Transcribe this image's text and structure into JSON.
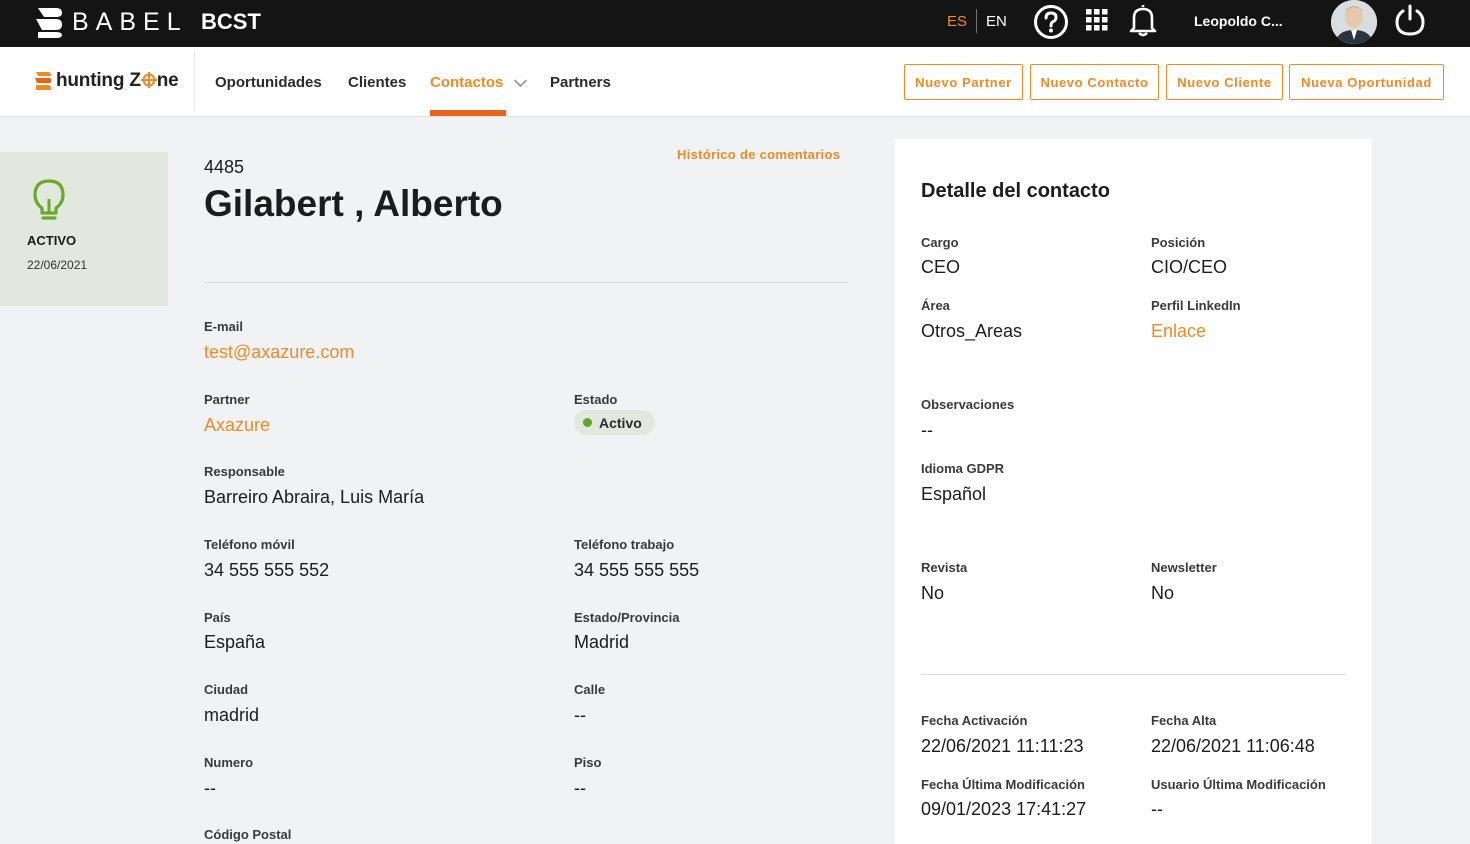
{
  "topbar": {
    "brand": "BABEL",
    "app": "BCST",
    "lang_es": "ES",
    "lang_en": "EN",
    "user_name": "Leopoldo C..."
  },
  "nav": {
    "logo_text_a": "hunting Z",
    "logo_text_b": "ne",
    "items": [
      "Oportunidades",
      "Clientes",
      "Contactos",
      "Partners"
    ],
    "active": "Contactos",
    "buttons": [
      "Nuevo Partner",
      "Nuevo Contacto",
      "Nuevo Cliente",
      "Nueva Oportunidad"
    ]
  },
  "status": {
    "label": "ACTIVO",
    "date": "22/06/2021"
  },
  "contact": {
    "id": "4485",
    "name": "Gilabert , Alberto",
    "history_link": "Histórico de comentarios",
    "fields": {
      "email_label": "E-mail",
      "email": "test@axazure.com",
      "partner_label": "Partner",
      "partner": "Axazure",
      "estado_label": "Estado",
      "estado": "Activo",
      "responsable_label": "Responsable",
      "responsable": "Barreiro Abraira, Luis María",
      "tel_movil_label": "Teléfono móvil",
      "tel_movil": "34 555 555 552",
      "tel_trabajo_label": "Teléfono trabajo",
      "tel_trabajo": "34 555 555 555",
      "pais_label": "País",
      "pais": "España",
      "provincia_label": "Estado/Provincia",
      "provincia": "Madrid",
      "ciudad_label": "Ciudad",
      "ciudad": "madrid",
      "calle_label": "Calle",
      "calle": "--",
      "numero_label": "Numero",
      "numero": "--",
      "piso_label": "Piso",
      "piso": "--",
      "cp_label": "Código Postal"
    }
  },
  "detail": {
    "title": "Detalle del contacto",
    "cargo_label": "Cargo",
    "cargo": "CEO",
    "posicion_label": "Posición",
    "posicion": "CIO/CEO",
    "area_label": "Área",
    "area": "Otros_Areas",
    "linkedin_label": "Perfil LinkedIn",
    "linkedin": "Enlace",
    "observaciones_label": "Observaciones",
    "observaciones": "--",
    "idioma_label": "Idioma GDPR",
    "idioma": "Español",
    "revista_label": "Revista",
    "revista": "No",
    "newsletter_label": "Newsletter",
    "newsletter": "No",
    "fecha_activacion_label": "Fecha Activación",
    "fecha_activacion": "22/06/2021 11:11:23",
    "fecha_alta_label": "Fecha Alta",
    "fecha_alta": "22/06/2021 11:06:48",
    "fecha_mod_label": "Fecha Última Modificación",
    "fecha_mod": "09/01/2023 17:41:27",
    "usuario_mod_label": "Usuario Última Modificación",
    "usuario_mod": "--"
  },
  "colors": {
    "accent": "#f08a24",
    "underline": "#e8641c",
    "topbar": "#141414",
    "status_bg": "#e2e8dd",
    "status_green": "#5fa531"
  },
  "icons": [
    "babel-logo-icon",
    "help-icon",
    "apps-grid-icon",
    "bell-icon",
    "power-icon",
    "hunting-zone-logo-icon",
    "chevron-down-icon",
    "lightbulb-icon"
  ]
}
